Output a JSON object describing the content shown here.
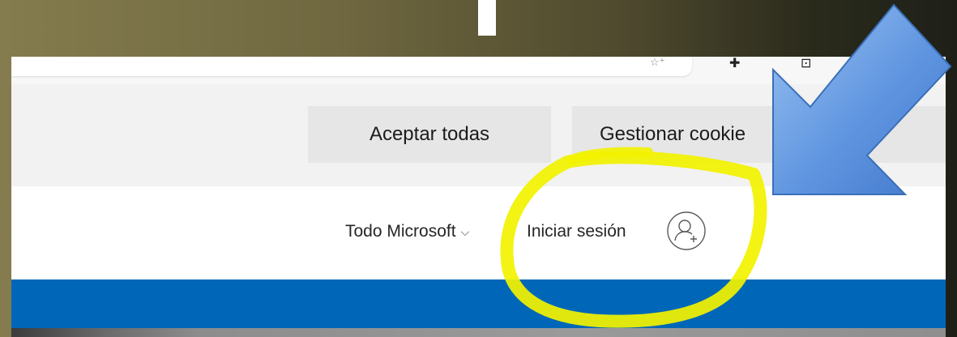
{
  "cookie_banner": {
    "accept_all_label": "Aceptar todas",
    "manage_cookies_label": "Gestionar cookie"
  },
  "header": {
    "all_microsoft_label": "Todo Microsoft",
    "all_microsoft_chevron": "⌵",
    "sign_in_label": "Iniciar sesión"
  },
  "annotations": {
    "highlight_color": "#f2f200",
    "arrow_color": "#5a8fe0"
  }
}
